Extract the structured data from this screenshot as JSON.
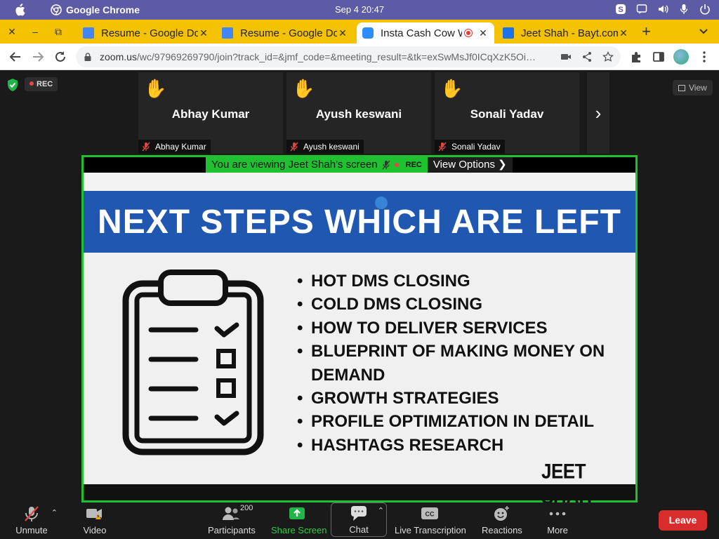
{
  "os": {
    "app_name": "Google Chrome",
    "clock": "Sep 4  20:47"
  },
  "browser": {
    "tabs": [
      {
        "title": "Resume - Google Docs",
        "favicon": "google-docs-icon",
        "color": "#4285f4"
      },
      {
        "title": "Resume - Google Docs",
        "favicon": "google-docs-icon",
        "color": "#4285f4"
      },
      {
        "title": "Insta Cash Cow W",
        "favicon": "zoom-icon",
        "color": "#2d8cff"
      },
      {
        "title": "Jeet Shah - Bayt.com",
        "favicon": "bayt-icon",
        "color": "#1a73e8"
      }
    ],
    "url_host": "zoom.us",
    "url_path": "/wc/97969269790/join?track_id=&jmf_code=&meeting_result=&tk=exSwMsJf0ICqXzK5Oi…"
  },
  "meeting": {
    "rec_label": "REC",
    "view_label": "View",
    "participants": [
      {
        "name": "Abhay Kumar"
      },
      {
        "name": "Ayush keswani"
      },
      {
        "name": "Sonali Yadav"
      }
    ],
    "share": {
      "viewing_text": "You are viewing Jeet Shah's screen",
      "rec_label": "REC",
      "view_options": "View Options ❯"
    },
    "slide": {
      "title": "NEXT STEPS WHICH ARE LEFT",
      "bullets": [
        "HOT DMS CLOSING",
        "COLD DMS CLOSING",
        "HOW TO DELIVER SERVICES",
        "BLUEPRINT OF MAKING MONEY ON DEMAND",
        "GROWTH STRATEGIES",
        "PROFILE OPTIMIZATION IN DETAIL",
        "HASHTAGS RESEARCH"
      ],
      "author": "JEET SHAH",
      "banner_color": "#1f57b1"
    }
  },
  "toolbar": {
    "unmute": "Unmute",
    "video": "Video",
    "participants": "Participants",
    "participants_count": "200",
    "share_screen": "Share Screen",
    "chat": "Chat",
    "live_transcription": "Live Transcription",
    "reactions": "Reactions",
    "more": "More",
    "leave": "Leave"
  },
  "colors": {
    "accent_green": "#20c130",
    "leave_red": "#d92d2d",
    "tab_strip": "#f5c200",
    "os_bar": "#5d5ba6"
  }
}
